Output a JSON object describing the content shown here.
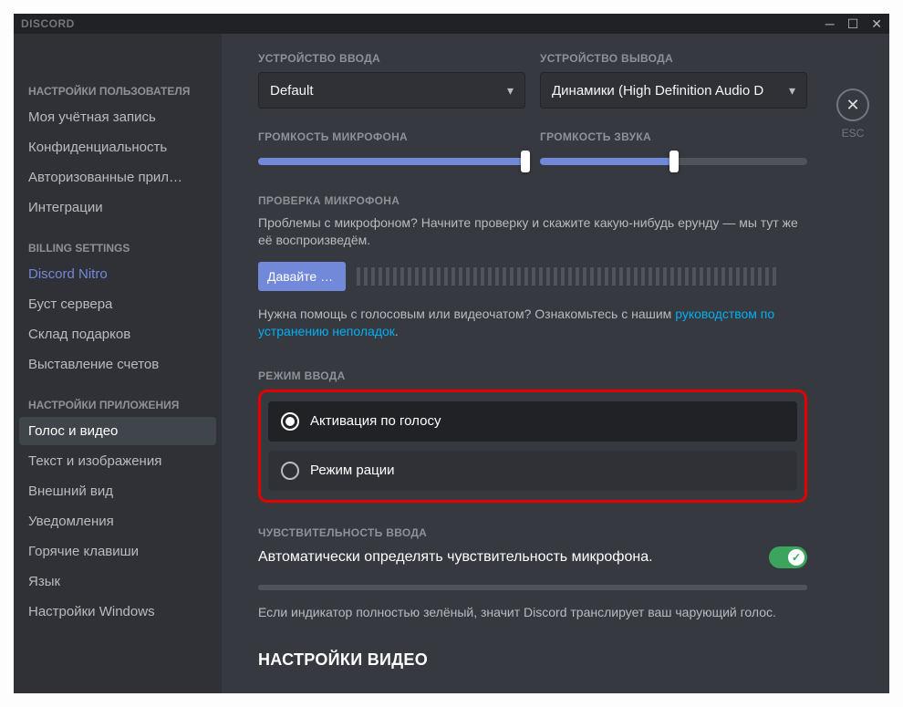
{
  "titlebar": {
    "brand": "DISCORD"
  },
  "close": {
    "label": "ESC"
  },
  "sidebar": {
    "headings": {
      "user": "НАСТРОЙКИ ПОЛЬЗОВАТЕЛЯ",
      "billing": "BILLING SETTINGS",
      "app": "НАСТРОЙКИ ПРИЛОЖЕНИЯ"
    },
    "user": [
      "Моя учётная запись",
      "Конфиденциальность",
      "Авторизованные прил…",
      "Интеграции"
    ],
    "billing": [
      "Discord Nitro",
      "Буст сервера",
      "Склад подарков",
      "Выставление счетов"
    ],
    "app": [
      "Голос и видео",
      "Текст и изображения",
      "Внешний вид",
      "Уведомления",
      "Горячие клавиши",
      "Язык",
      "Настройки Windows"
    ]
  },
  "devices": {
    "input_heading": "УСТРОЙСТВО ВВОДА",
    "output_heading": "УСТРОЙСТВО ВЫВОДА",
    "input_value": "Default",
    "output_value": "Динамики (High Definition Audio D"
  },
  "volume": {
    "input_heading": "ГРОМКОСТЬ МИКРОФОНА",
    "output_heading": "ГРОМКОСТЬ ЗВУКА",
    "input_percent": 100,
    "output_percent": 50
  },
  "mic_test": {
    "heading": "ПРОВЕРКА МИКРОФОНА",
    "desc": "Проблемы с микрофоном? Начните проверку и скажите какую-нибудь ерунду — мы тут же её воспроизведём.",
    "button": "Давайте пр…",
    "help_prefix": "Нужна помощь с голосовым или видеочатом? Ознакомьтесь с нашим ",
    "help_link": "руководством по устранению неполадок",
    "help_suffix": "."
  },
  "input_mode": {
    "heading": "РЕЖИМ ВВОДА",
    "options": [
      "Активация по голосу",
      "Режим рации"
    ],
    "selected_index": 0
  },
  "sensitivity": {
    "heading": "ЧУВСТВИТЕЛЬНОСТЬ ВВОДА",
    "auto_label": "Автоматически определять чувствительность микрофона.",
    "auto_on": true,
    "hint": "Если индикатор полностью зелёный, значит Discord транслирует ваш чарующий голос."
  },
  "video": {
    "heading": "НАСТРОЙКИ ВИДЕО"
  }
}
